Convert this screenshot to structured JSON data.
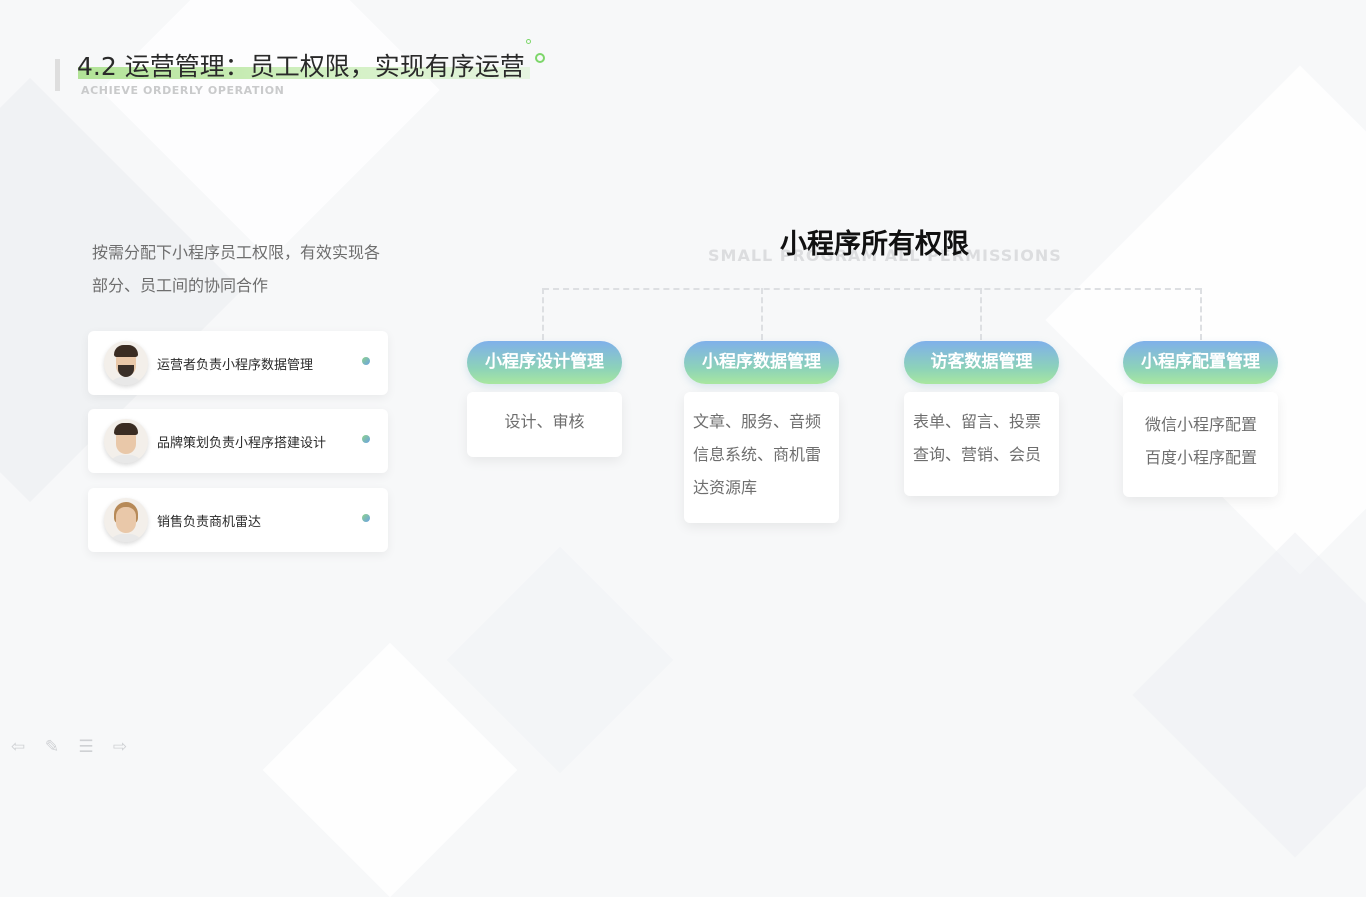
{
  "header": {
    "title": "4.2 运营管理：员工权限，实现有序运营",
    "subtitle": "ACHIEVE ORDERLY OPERATION"
  },
  "description": {
    "line1": "按需分配下小程序员工权限，有效实现各",
    "line2": "部分、员工间的协同合作"
  },
  "roles": [
    {
      "text": "运营者负责小程序数据管理"
    },
    {
      "text": "品牌策划负责小程序搭建设计"
    },
    {
      "text": "销售负责商机雷达"
    }
  ],
  "diagram": {
    "title": "小程序所有权限",
    "subtitle": "SMALL PROGRAM ALL PERMISSIONS",
    "categories": [
      {
        "label": "小程序设计管理",
        "lines": [
          "设计、审核"
        ]
      },
      {
        "label": "小程序数据管理",
        "lines": [
          "文章、服务、音频",
          "信息系统、商机雷",
          "达资源库"
        ]
      },
      {
        "label": "访客数据管理",
        "lines": [
          "表单、留言、投票",
          "查询、营销、会员"
        ]
      },
      {
        "label": "小程序配置管理",
        "lines": [
          "微信小程序配置",
          "百度小程序配置"
        ]
      }
    ]
  },
  "toolbar": {
    "icons": [
      "arrow-left-icon",
      "pen-icon",
      "menu-icon",
      "arrow-right-icon"
    ],
    "glyphs": [
      "⇦",
      "✎",
      "☰",
      "⇨"
    ]
  },
  "colors": {
    "accent_green": "#7dd66a",
    "pill_top": "#7fb0ea",
    "pill_bottom": "#a9e7a0"
  }
}
